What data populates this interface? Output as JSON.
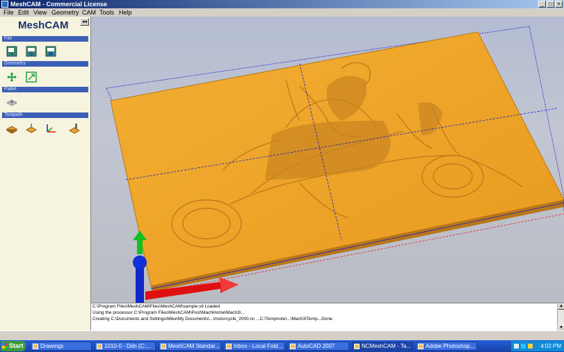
{
  "window": {
    "title": "MeshCAM - Commercial License"
  },
  "menu": [
    "File",
    "Edit",
    "View",
    "Geometry",
    "CAM",
    "Tools",
    "Help"
  ],
  "panel": {
    "logo": "MeshCAM",
    "sections": [
      "File",
      "Geometry",
      "Pallet",
      "Toolpath"
    ]
  },
  "log": {
    "lines": [
      "C:\\Program Files\\MeshCAM\\Files\\MeshCAM\\sample.stl Loaded",
      "Using the processor C:\\Program Files\\MeshCAM\\Post\\MachHome\\Mach3\\...",
      "Creating C:\\Documents and Settings\\Mike\\My Documents\\...\\motorcycle_2000.nc ...C:\\Tempnote\\...\\Mach3\\Temp...Done."
    ]
  },
  "taskbar": {
    "start": "Start",
    "tasks": [
      "Drawings",
      "1010-0 - Ddn (C:...",
      "MeshCAM Standar...",
      "Inbox - Local Fold...",
      "AutoCAD 2007",
      "NCMeshCAM - Ta...",
      "Adobe Photoshop..."
    ],
    "time": "4:02 PM"
  },
  "colors": {
    "relief": "#f0a528",
    "bounding_box": "#1818c8",
    "axis_x": "#e01010",
    "axis_y": "#10c020",
    "axis_z": "#1028c8"
  }
}
